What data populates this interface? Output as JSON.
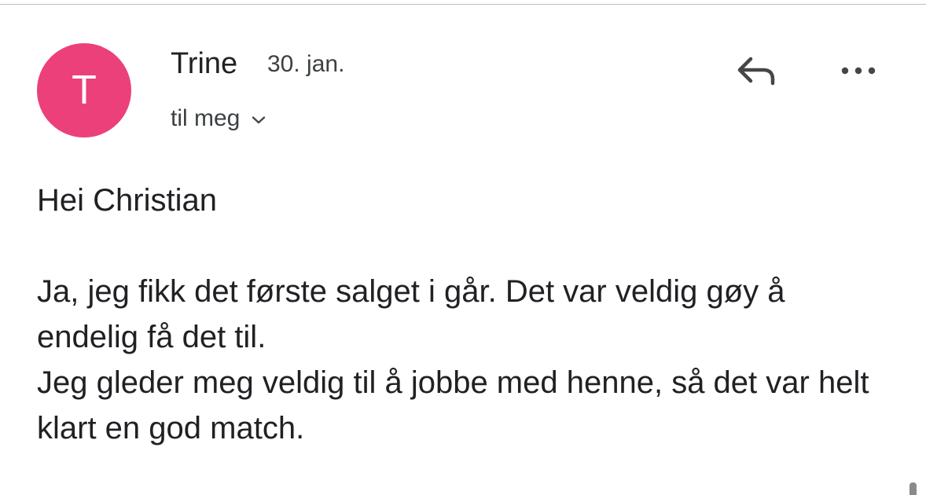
{
  "message": {
    "sender": {
      "initial": "T",
      "name": "Trine",
      "avatar_color": "#EC407A"
    },
    "date": "30. jan.",
    "recipient_label": "til meg",
    "body": {
      "greeting": "Hei Christian",
      "lines": [
        "Ja, jeg fikk det første salget i går. Det var veldig gøy å endelig få det til.",
        "Jeg gleder meg veldig til å jobbe med henne, så det var helt klart en god match."
      ]
    }
  },
  "actions": {
    "reply_icon": "reply-icon",
    "more_icon": "more-horizontal-icon",
    "expand_icon": "chevron-down-icon"
  },
  "colors": {
    "text_primary": "#202124",
    "text_secondary": "#3c4043",
    "icon": "#444746"
  }
}
